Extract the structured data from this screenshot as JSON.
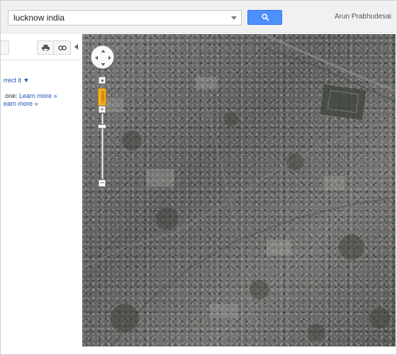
{
  "search": {
    "value": "lucknow india"
  },
  "header": {
    "user_name": "Arun Prabhudesai"
  },
  "left_panel": {
    "correct_link": "rrect it ▼",
    "line1_text": "one: ",
    "line1_link": "Learn more »",
    "line2_link": "earn more »"
  },
  "map": {
    "view": "satellite",
    "zoom_level_fraction": 0.17
  },
  "icons": {
    "search": "search-icon",
    "print": "print-icon",
    "link": "link-icon",
    "pan": "pan-arrows-icon",
    "pegman": "pegman-icon"
  },
  "colors": {
    "search_button": "#4d90fe",
    "link": "#1a55b3",
    "pegman": "#f4b521"
  }
}
